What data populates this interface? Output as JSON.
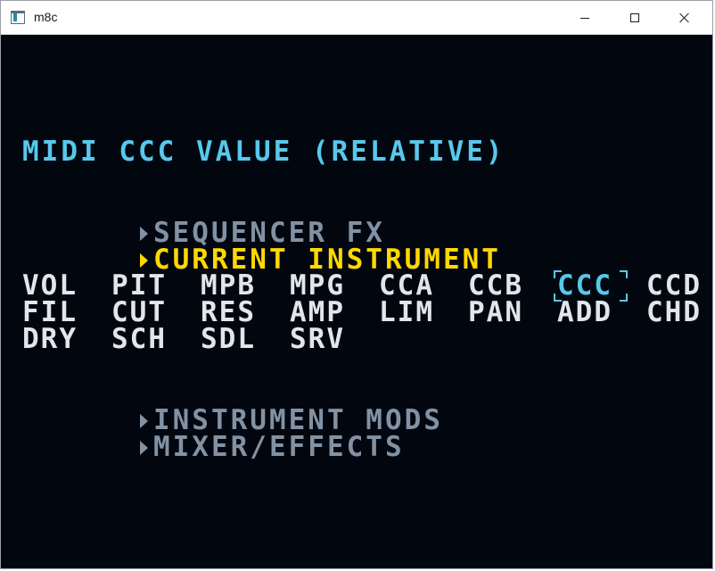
{
  "window": {
    "title": "m8c"
  },
  "screen": {
    "heading": "MIDI CCC VALUE (RELATIVE)",
    "menu_top": [
      {
        "label": "SEQUENCER FX",
        "active": false
      },
      {
        "label": "CURRENT INSTRUMENT",
        "active": true
      }
    ],
    "params": [
      [
        "VOL",
        "PIT",
        "MPB",
        "MPG",
        "CCA",
        "CCB",
        "CCC",
        "CCD"
      ],
      [
        "FIL",
        "CUT",
        "RES",
        "AMP",
        "LIM",
        "PAN",
        "ADD",
        "CHD"
      ],
      [
        "DRY",
        "SCH",
        "SDL",
        "SRV"
      ]
    ],
    "selected_param": "CCC",
    "menu_bottom": [
      {
        "label": "INSTRUMENT MODS",
        "active": false
      },
      {
        "label": "MIXER/EFFECTS",
        "active": false
      }
    ],
    "colors": {
      "background": "#02070f",
      "heading": "#57c8ec",
      "menu_inactive": "#8292a4",
      "menu_active": "#ffd800",
      "param_text": "#e2e6ea",
      "selection": "#57c8ec"
    }
  }
}
